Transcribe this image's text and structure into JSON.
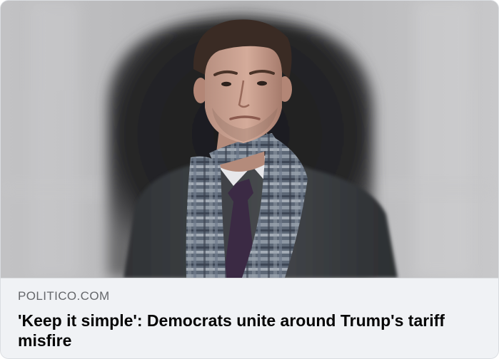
{
  "link_preview": {
    "domain": "POLITICO.COM",
    "headline": "'Keep it simple': Democrats unite around Trump's tariff misfire"
  },
  "image": {
    "subject": "portrait-photo"
  },
  "colors": {
    "preview_background": "#f0f2f5",
    "domain_text": "#65676b",
    "headline_text": "#050505"
  }
}
